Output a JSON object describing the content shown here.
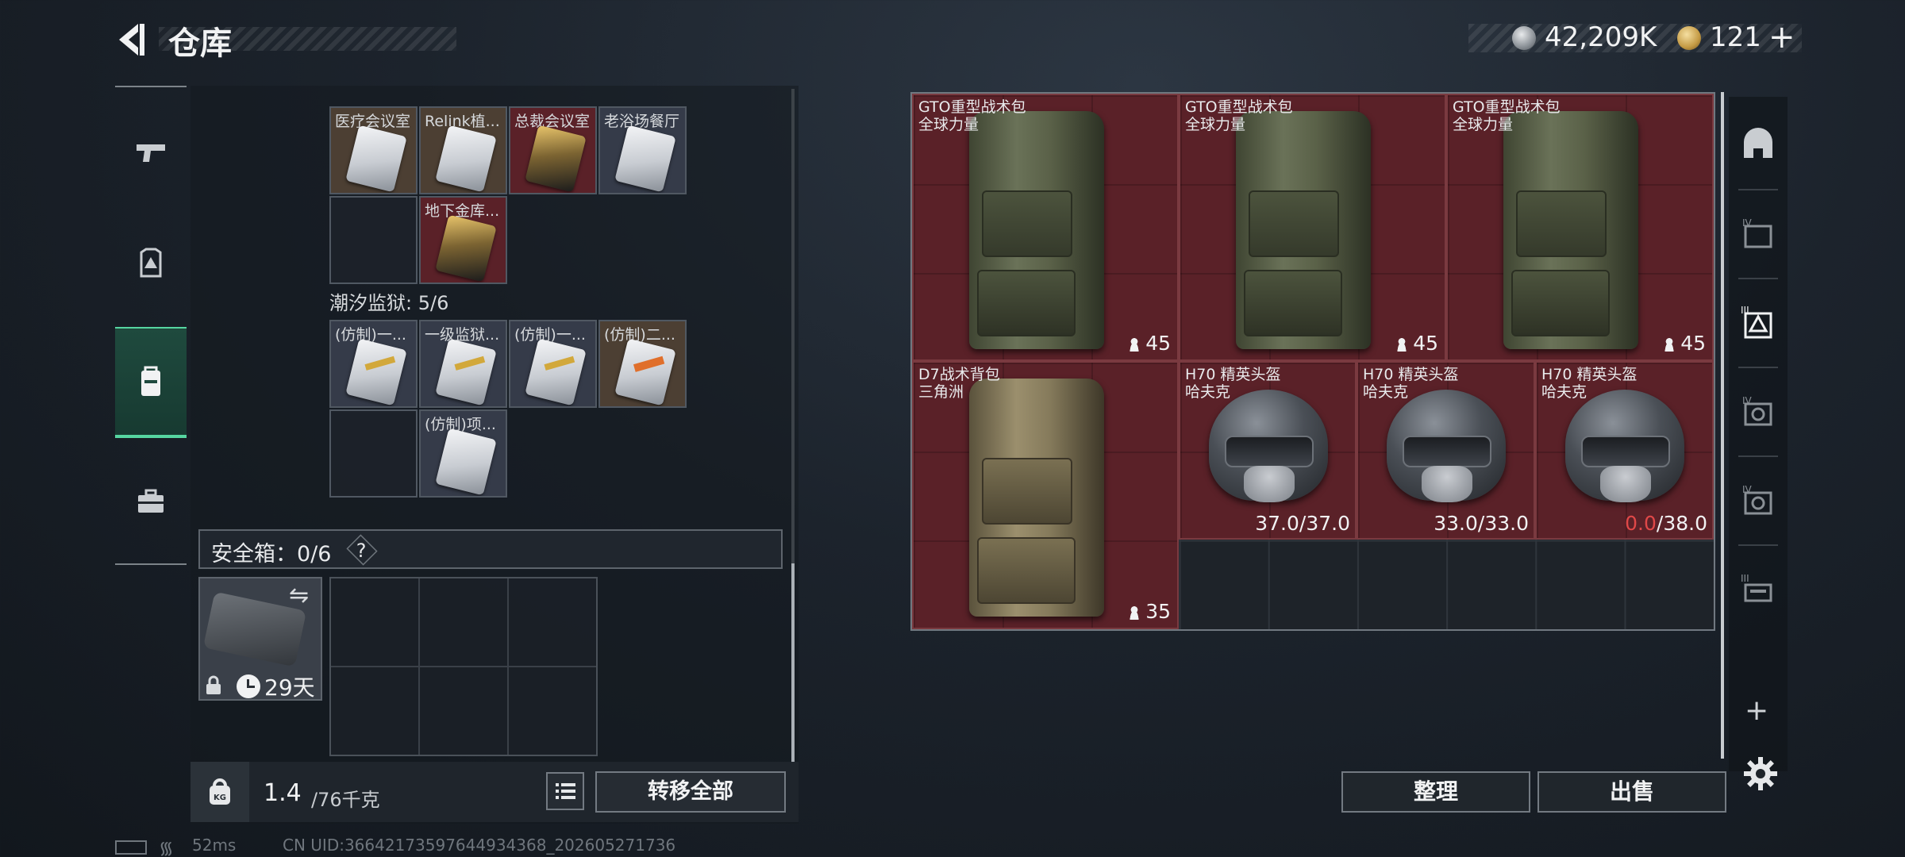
{
  "header": {
    "title": "仓库",
    "currency": {
      "money": "42,209K",
      "bonds": "121"
    }
  },
  "left_tabs": [
    {
      "icon": "pistol-icon",
      "active": false
    },
    {
      "icon": "armor-vest-icon",
      "active": false
    },
    {
      "icon": "backpack-icon",
      "active": true
    },
    {
      "icon": "briefcase-icon",
      "active": false
    }
  ],
  "keycards_top": [
    {
      "label": "医疗会议室",
      "style": "gold"
    },
    {
      "label": "Relink植...",
      "style": "gold"
    },
    {
      "label": "总裁会议室",
      "style": "red"
    },
    {
      "label": "老浴场餐厅",
      "style": "grey"
    },
    {
      "label": "地下金库...",
      "style": "red"
    }
  ],
  "section_tidal_prison": {
    "label": "潮汐监狱: 5/6"
  },
  "keycards_prison": [
    {
      "label": "(仿制)一...",
      "style": "grey"
    },
    {
      "label": "一级监狱...",
      "style": "grey"
    },
    {
      "label": "(仿制)一...",
      "style": "grey"
    },
    {
      "label": "(仿制)二...",
      "style": "gold"
    },
    {
      "label": "(仿制)项...",
      "style": "grey"
    }
  ],
  "safebox": {
    "label": "安全箱：0/6",
    "help": "?",
    "days": "29天"
  },
  "footer_left": {
    "weight": "1.4",
    "capacity": "/76千克",
    "kg_icon_text": "KG",
    "transfer_all": "转移全部"
  },
  "stash_items": [
    {
      "name": "GTO重型战术包\n全球力量",
      "capacity": "45"
    },
    {
      "name": "GTO重型战术包\n全球力量",
      "capacity": "45"
    },
    {
      "name": "GTO重型战术包\n全球力量",
      "capacity": "45"
    },
    {
      "name": "D7战术背包\n三角洲",
      "capacity": "35"
    },
    {
      "name": "H70 精英头盔\n哈夫克",
      "durability": "37.0",
      "max": "/37.0"
    },
    {
      "name": "H70 精英头盔\n哈夫克",
      "durability": "33.0",
      "max": "/33.0"
    },
    {
      "name": "H70 精英头盔\n哈夫克",
      "durability": "0.0",
      "max": "/38.0",
      "broken": true
    }
  ],
  "buttons": {
    "sort": "整理",
    "sell": "出售"
  },
  "right_tabs": [
    "stash-main-icon",
    "stash-iv-icon",
    "stash-iii-active-icon",
    "stash-iv-b-icon",
    "stash-iv-c-icon",
    "stash-iii-icon"
  ],
  "status": {
    "ping": "52ms",
    "uid": "CN UID:3664217359764493436​8_202605271736"
  },
  "colors": {
    "accent": "#56d6a1",
    "item_bg": "#5a2128",
    "broken": "#e04848"
  }
}
